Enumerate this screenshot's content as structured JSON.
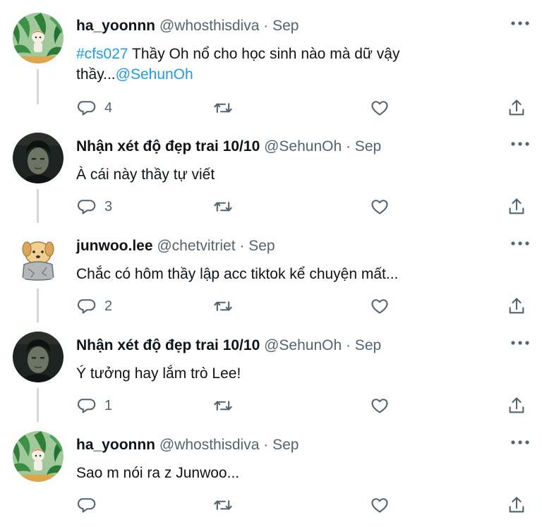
{
  "colors": {
    "link": "#1d9bf0",
    "icon": "#536471",
    "thread_line": "#cfd9de"
  },
  "tweets": [
    {
      "display_name": "ha_yoonnn",
      "handle_line": "@whosthisdiva · Sep",
      "avatar_icon": "cartoon-character-leaves-avatar",
      "hashtag": "#cfs027",
      "text_main": " Thầy Oh nổ cho học sinh nào mà dữ vậy thầy...",
      "mention": "@SehunOh",
      "replies": "4",
      "retweets": "",
      "likes": ""
    },
    {
      "display_name": "Nhận xét độ đẹp trai 10/10",
      "handle_line": "@SehunOh · Sep",
      "avatar_icon": "man-portrait-avatar",
      "text": "À cái này thầy tự viết",
      "replies": "3",
      "retweets": "",
      "likes": ""
    },
    {
      "display_name": "junwoo.lee",
      "handle_line": "@chetvitriet · Sep",
      "avatar_icon": "dog-sticker-avatar",
      "text": "Chắc có hôm thầy lập acc tiktok kể chuyện mất...",
      "replies": "2",
      "retweets": "",
      "likes": ""
    },
    {
      "display_name": "Nhận xét độ đẹp trai 10/10",
      "handle_line": "@SehunOh · Sep",
      "avatar_icon": "man-portrait-avatar",
      "text": "Ý tưởng hay lắm trò Lee!",
      "replies": "1",
      "retweets": "",
      "likes": ""
    },
    {
      "display_name": "ha_yoonnn",
      "handle_line": "@whosthisdiva · Sep",
      "avatar_icon": "cartoon-character-leaves-avatar",
      "text": "Sao m nói ra z Junwoo...",
      "replies": "",
      "retweets": "",
      "likes": ""
    }
  ]
}
